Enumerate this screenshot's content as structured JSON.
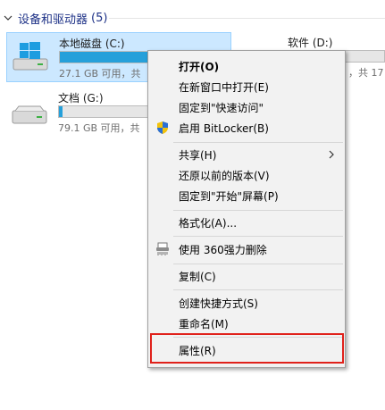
{
  "section": {
    "title": "设备和驱动器",
    "count": "(5)"
  },
  "drives": [
    {
      "name": "本地磁盘 (C:)",
      "info": "27.1 GB 可用，共",
      "used_fraction": 0.6,
      "selected": true
    },
    {
      "name": "软件 (D:)",
      "info": "，共 17",
      "used_fraction": 0.4,
      "selected": false
    },
    {
      "name": "文档 (G:)",
      "info": "79.1 GB 可用，共",
      "used_fraction": 0.02,
      "selected": false
    }
  ],
  "context_menu": {
    "items": [
      {
        "label": "打开(O)",
        "bold": true
      },
      {
        "label": "在新窗口中打开(E)"
      },
      {
        "label": "固定到\"快速访问\""
      },
      {
        "label": "启用 BitLocker(B)",
        "icon": "shield-icon"
      },
      {
        "label": "共享(H)",
        "submenu": true
      },
      {
        "label": "还原以前的版本(V)"
      },
      {
        "label": "固定到\"开始\"屏幕(P)"
      },
      {
        "label": "格式化(A)..."
      },
      {
        "label": "使用 360强力删除",
        "icon": "shredder-icon"
      },
      {
        "label": "复制(C)"
      },
      {
        "label": "创建快捷方式(S)"
      },
      {
        "label": "重命名(M)"
      },
      {
        "label": "属性(R)",
        "highlighted": true
      }
    ]
  },
  "colors": {
    "accent": "#26a0da",
    "selection": "#cce8ff",
    "section_title": "#1e3287",
    "highlight_border": "#e0211b"
  }
}
